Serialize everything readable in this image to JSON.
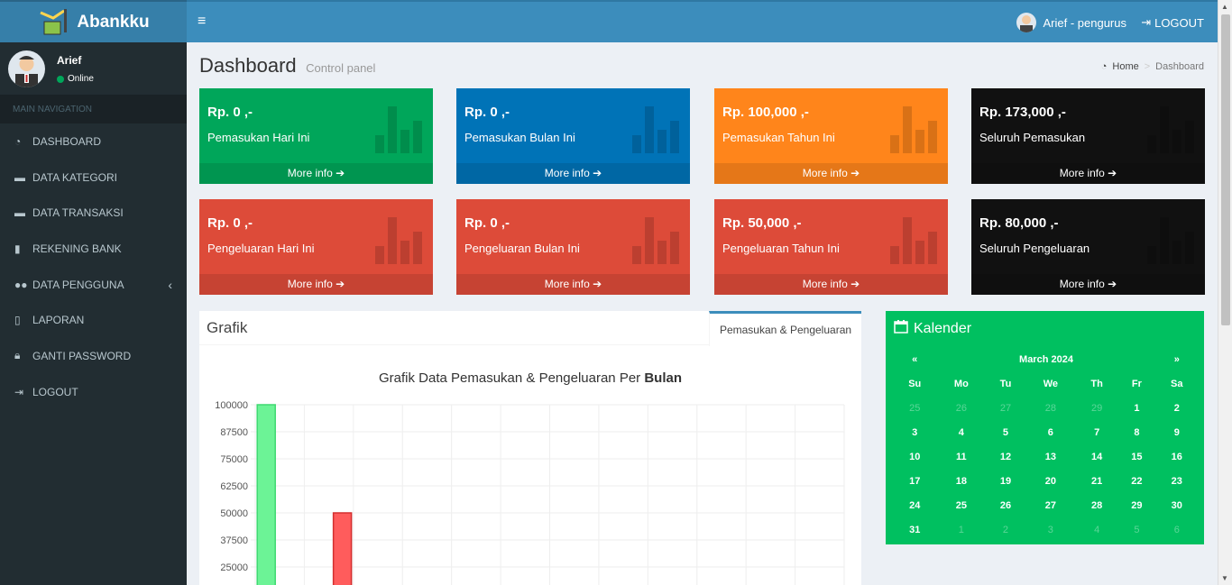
{
  "app": {
    "name": "Abankku"
  },
  "navbar": {
    "user_label": "Arief - pengurus",
    "logout_label": "LOGOUT"
  },
  "sidebar": {
    "user_name": "Arief",
    "status": "Online",
    "nav_header": "MAIN NAVIGATION",
    "items": [
      {
        "label": "DASHBOARD",
        "icon": "dashboard-icon"
      },
      {
        "label": "DATA KATEGORI",
        "icon": "folder-icon"
      },
      {
        "label": "DATA TRANSAKSI",
        "icon": "folder-icon"
      },
      {
        "label": "REKENING BANK",
        "icon": "book-icon"
      },
      {
        "label": "DATA PENGGUNA",
        "icon": "users-icon"
      },
      {
        "label": "LAPORAN",
        "icon": "file-icon"
      },
      {
        "label": "GANTI PASSWORD",
        "icon": "lock-icon"
      },
      {
        "label": "LOGOUT",
        "icon": "sign-out-icon"
      }
    ]
  },
  "header": {
    "title": "Dashboard",
    "subtitle": "Control panel"
  },
  "breadcrumb": {
    "home": "Home",
    "current": "Dashboard"
  },
  "boxes": [
    {
      "amount": "Rp. 0 ,-",
      "label": "Pemasukan Hari Ini",
      "more": "More info",
      "color": "#00a65a"
    },
    {
      "amount": "Rp. 0 ,-",
      "label": "Pemasukan Bulan Ini",
      "more": "More info",
      "color": "#0073b7"
    },
    {
      "amount": "Rp. 100,000 ,-",
      "label": "Pemasukan Tahun Ini",
      "more": "More info",
      "color": "#ff851b"
    },
    {
      "amount": "Rp. 173,000 ,-",
      "label": "Seluruh Pemasukan",
      "more": "More info",
      "color": "#111111"
    },
    {
      "amount": "Rp. 0 ,-",
      "label": "Pengeluaran Hari Ini",
      "more": "More info",
      "color": "#dd4b39"
    },
    {
      "amount": "Rp. 0 ,-",
      "label": "Pengeluaran Bulan Ini",
      "more": "More info",
      "color": "#dd4b39"
    },
    {
      "amount": "Rp. 50,000 ,-",
      "label": "Pengeluaran Tahun Ini",
      "more": "More info",
      "color": "#dd4b39"
    },
    {
      "amount": "Rp. 80,000 ,-",
      "label": "Seluruh Pengeluaran",
      "more": "More info",
      "color": "#111111"
    }
  ],
  "grafik": {
    "title": "Grafik",
    "tab_label": "Pemasukan & Pengeluaran",
    "chart_title_prefix": "Grafik Data Pemasukan & Pengeluaran Per",
    "chart_title_bold": "Bulan"
  },
  "chart_data": {
    "type": "bar",
    "title": "Grafik Data Pemasukan & Pengeluaran Per Bulan",
    "yticks": [
      100000,
      87500,
      75000,
      62500,
      50000,
      37500,
      25000
    ],
    "ylim": [
      0,
      100000
    ],
    "categories": [
      "",
      "",
      "",
      "",
      "",
      "",
      "",
      "",
      "",
      "",
      "",
      ""
    ],
    "series": [
      {
        "values": [
          100000,
          0,
          0,
          0,
          0,
          0,
          0,
          0,
          0,
          0,
          0,
          0
        ],
        "color": "#6cf396"
      },
      {
        "values": [
          0,
          50000,
          0,
          0,
          0,
          0,
          0,
          0,
          0,
          0,
          0,
          0
        ],
        "color": "#ff5c5c"
      }
    ],
    "grid": true
  },
  "calendar": {
    "title": "Kalender",
    "month": "March 2024",
    "prev": "«",
    "next": "»",
    "weekdays": [
      "Su",
      "Mo",
      "Tu",
      "We",
      "Th",
      "Fr",
      "Sa"
    ],
    "weeks": [
      [
        "25",
        "26",
        "27",
        "28",
        "29",
        "1",
        "2"
      ],
      [
        "3",
        "4",
        "5",
        "6",
        "7",
        "8",
        "9"
      ],
      [
        "10",
        "11",
        "12",
        "13",
        "14",
        "15",
        "16"
      ],
      [
        "17",
        "18",
        "19",
        "20",
        "21",
        "22",
        "23"
      ],
      [
        "24",
        "25",
        "26",
        "27",
        "28",
        "29",
        "30"
      ],
      [
        "31",
        "1",
        "2",
        "3",
        "4",
        "5",
        "6"
      ]
    ],
    "muted_first_row": 5,
    "muted_last_row_from": 1
  }
}
